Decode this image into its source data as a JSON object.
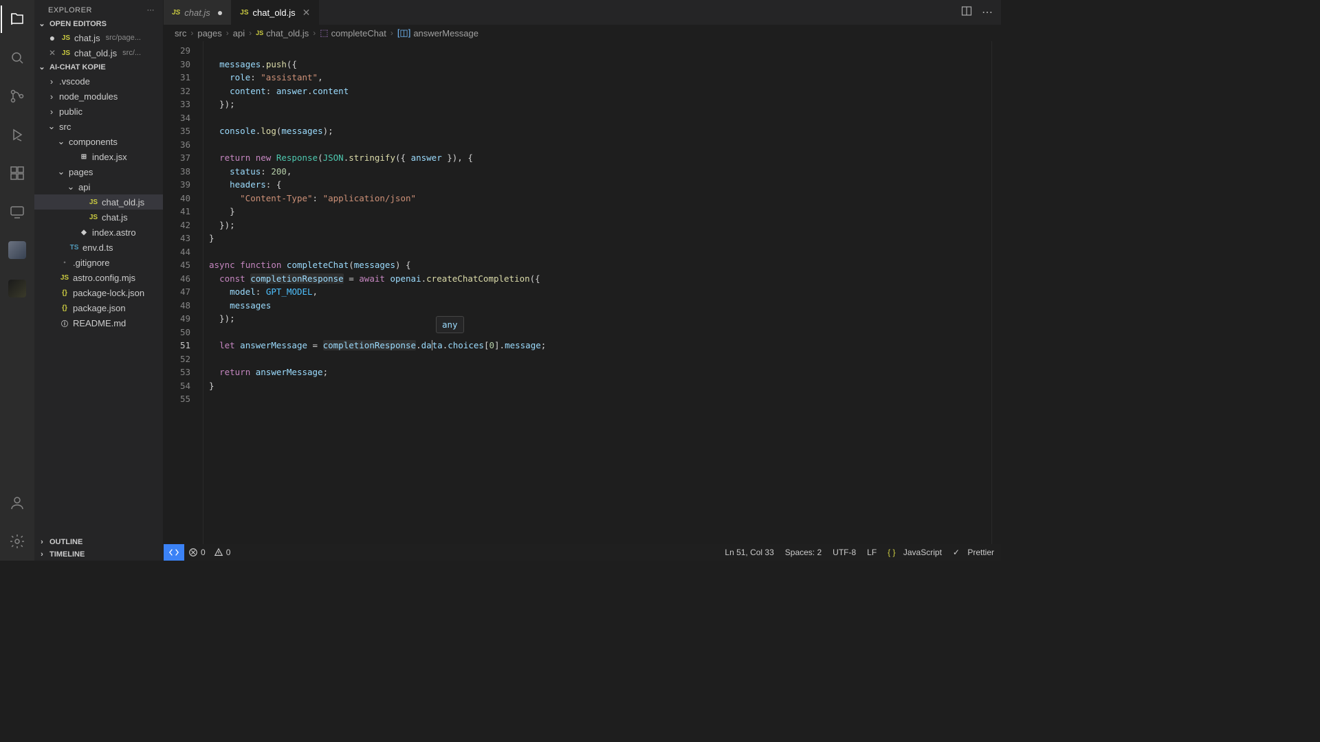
{
  "explorer": {
    "title": "EXPLORER",
    "sections": {
      "openEditors": "OPEN EDITORS",
      "project": "AI-CHAT KOPIE",
      "outline": "OUTLINE",
      "timeline": "TIMELINE"
    },
    "openEditorItems": [
      {
        "name": "chat.js",
        "hint": "src/page...",
        "modified": true,
        "icon": "JS",
        "iconClass": "icon-js"
      },
      {
        "name": "chat_old.js",
        "hint": "src/...",
        "modified": false,
        "icon": "JS",
        "iconClass": "icon-js",
        "close": true
      }
    ],
    "tree": [
      {
        "type": "folder",
        "name": ".vscode",
        "indent": 1
      },
      {
        "type": "folder",
        "name": "node_modules",
        "indent": 1
      },
      {
        "type": "folder",
        "name": "public",
        "indent": 1
      },
      {
        "type": "folder",
        "name": "src",
        "indent": 1,
        "open": true
      },
      {
        "type": "folder",
        "name": "components",
        "indent": 2,
        "open": true
      },
      {
        "type": "file",
        "name": "index.jsx",
        "icon": "⊞",
        "iconClass": "",
        "indent": 3
      },
      {
        "type": "folder",
        "name": "pages",
        "indent": 2,
        "open": true
      },
      {
        "type": "folder",
        "name": "api",
        "indent": 3,
        "open": true
      },
      {
        "type": "file",
        "name": "chat_old.js",
        "icon": "JS",
        "iconClass": "icon-js",
        "indent": 4,
        "selected": true
      },
      {
        "type": "file",
        "name": "chat.js",
        "icon": "JS",
        "iconClass": "icon-js",
        "indent": 4
      },
      {
        "type": "file",
        "name": "index.astro",
        "icon": "◆",
        "iconClass": "",
        "indent": 3
      },
      {
        "type": "file",
        "name": "env.d.ts",
        "icon": "TS",
        "iconClass": "icon-ts",
        "indent": 2
      },
      {
        "type": "file",
        "name": ".gitignore",
        "icon": "◦",
        "iconClass": "",
        "indent": 1
      },
      {
        "type": "file",
        "name": "astro.config.mjs",
        "icon": "JS",
        "iconClass": "icon-js",
        "indent": 1
      },
      {
        "type": "file",
        "name": "package-lock.json",
        "icon": "{}",
        "iconClass": "icon-json",
        "indent": 1
      },
      {
        "type": "file",
        "name": "package.json",
        "icon": "{}",
        "iconClass": "icon-json",
        "indent": 1
      },
      {
        "type": "file",
        "name": "README.md",
        "icon": "ⓘ",
        "iconClass": "",
        "indent": 1
      }
    ]
  },
  "tabs": [
    {
      "name": "chat.js",
      "icon": "JS",
      "active": false,
      "modified": true
    },
    {
      "name": "chat_old.js",
      "icon": "JS",
      "active": true,
      "modified": false
    }
  ],
  "breadcrumb": [
    {
      "label": "src"
    },
    {
      "label": "pages"
    },
    {
      "label": "api"
    },
    {
      "label": "chat_old.js",
      "icon": "JS",
      "iconClass": "icon-js"
    },
    {
      "label": "completeChat",
      "icon": "cube"
    },
    {
      "label": "answerMessage",
      "icon": "var"
    }
  ],
  "editor": {
    "firstLine": 29,
    "currentLine": 51,
    "hoverTip": "any",
    "lines": [
      "",
      "  messages.push({",
      "    role: \"assistant\",",
      "    content: answer.content",
      "  });",
      "",
      "  console.log(messages);",
      "",
      "  return new Response(JSON.stringify({ answer }), {",
      "    status: 200,",
      "    headers: {",
      "      \"Content-Type\": \"application/json\"",
      "    }",
      "  });",
      "}",
      "",
      "async function completeChat(messages) {",
      "  const completionResponse = await openai.createChatCompletion({",
      "    model: GPT_MODEL,",
      "    messages",
      "  });",
      "",
      "  let answerMessage = completionResponse.data.choices[0].message;",
      "",
      "  return answerMessage;",
      "}",
      ""
    ]
  },
  "status": {
    "errors": "0",
    "warnings": "0",
    "ln": "Ln 51, Col 33",
    "spaces": "Spaces: 2",
    "encoding": "UTF-8",
    "eol": "LF",
    "lang": "JavaScript",
    "prettier": "Prettier"
  }
}
